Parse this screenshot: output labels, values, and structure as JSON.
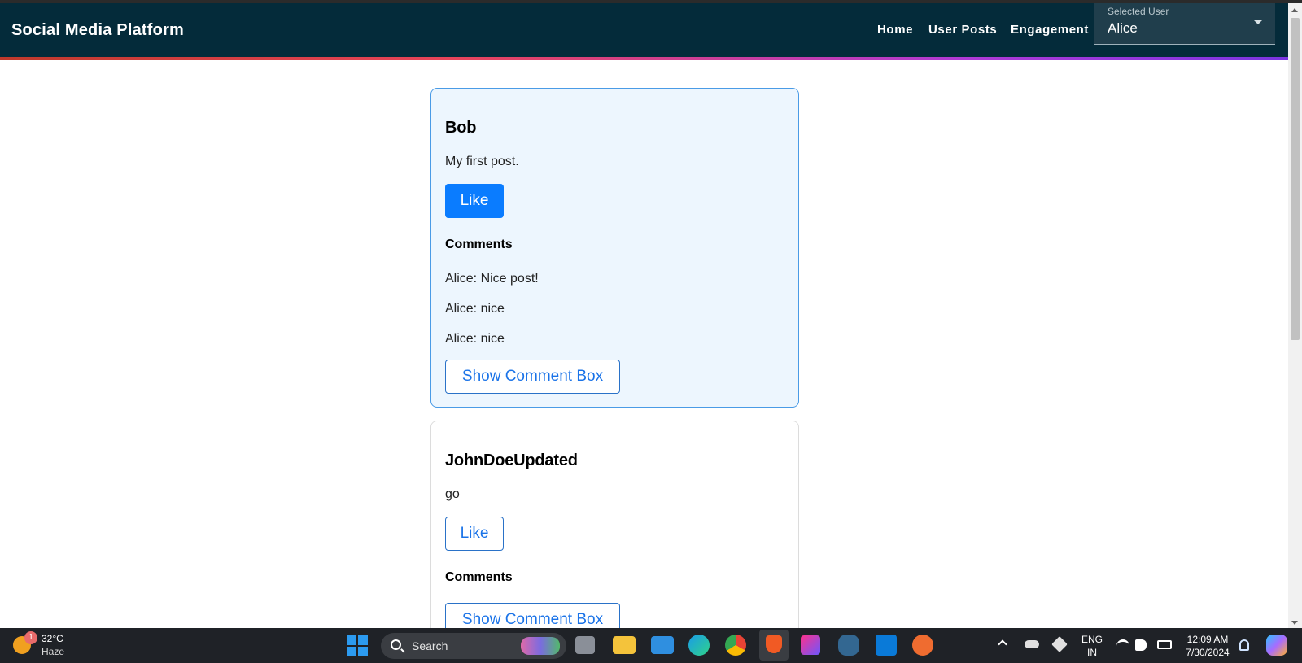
{
  "appbar": {
    "title": "Social Media Platform",
    "nav": [
      "Home",
      "User Posts",
      "Engagement"
    ],
    "user_select": {
      "label": "Selected User",
      "value": "Alice"
    }
  },
  "posts": [
    {
      "author": "Bob",
      "content": "My first post.",
      "like_label": "Like",
      "comments_title": "Comments",
      "comments": [
        "Alice: Nice post!",
        "Alice: nice",
        "Alice: nice"
      ],
      "comment_box_label": "Show Comment Box"
    },
    {
      "author": "JohnDoeUpdated",
      "content": "go",
      "like_label": "Like",
      "comments_title": "Comments",
      "comments": [],
      "comment_box_label": "Show Comment Box"
    }
  ],
  "taskbar": {
    "weather": {
      "badge": "1",
      "temp": "32°C",
      "condition": "Haze"
    },
    "search_label": "Search",
    "apps": [
      "task-view-icon",
      "file-explorer-icon",
      "mail-icon",
      "edge-icon",
      "chrome-icon",
      "brave-icon",
      "intellij-icon",
      "postgres-icon",
      "vscode-icon",
      "postman-icon"
    ],
    "language": {
      "line1": "ENG",
      "line2": "IN"
    },
    "time": "12:09 AM",
    "date": "7/30/2024"
  },
  "colors": {
    "appbar_bg": "#042b3a",
    "accent_blue": "#0a7cff",
    "selected_card_bg": "#edf6fe"
  }
}
